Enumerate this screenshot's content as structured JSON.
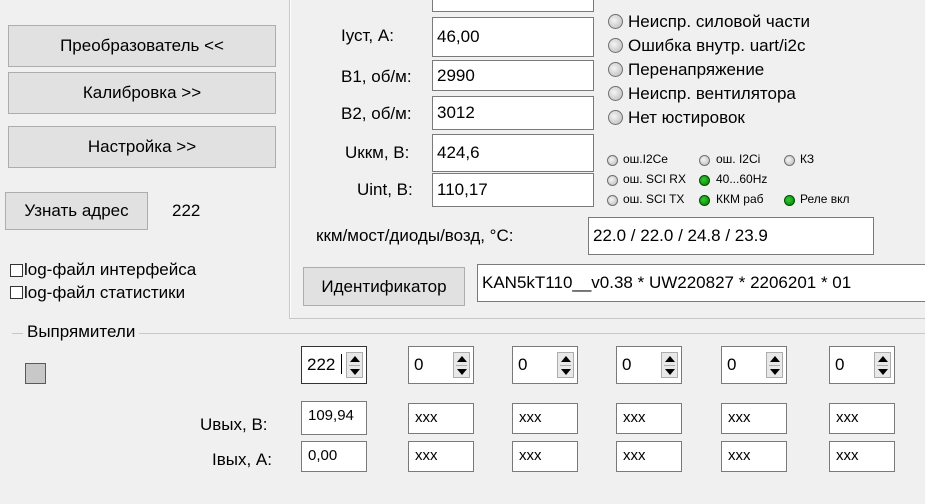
{
  "left": {
    "converter_button": "Преобразователь <<",
    "calibration_button": "Калибровка >>",
    "settings_button": "Настройка >>",
    "get_address_button": "Узнать адрес",
    "address_value": "222",
    "log_interface_label": "log-файл интерфейса",
    "log_stats_label": "log-файл статистики"
  },
  "measurements": {
    "iust_label": "Iуст, А:",
    "iust_value": "46,00",
    "b1_label": "В1, об/м:",
    "b1_value": "2990",
    "b2_label": "В2, об/м:",
    "b2_value": "3012",
    "ukkm_label": "Uккм, В:",
    "ukkm_value": "424,6",
    "uint_label": "Uint, В:",
    "uint_value": "110,17",
    "temps_label": "ккм/мост/диоды/возд, °С:",
    "temps_value": "22.0 / 22.0 / 24.8 / 23.9"
  },
  "faults": [
    "Неиспр. силовой части",
    "Ошибка внутр. uart/i2c",
    "Перенапряжение",
    "Неиспр. вентилятора",
    "Нет юстировок"
  ],
  "small_indicators": {
    "row1": [
      "ош.I2Ce",
      "ош. I2Ci",
      "КЗ"
    ],
    "row2": [
      "ош. SCI RX",
      "40...60Hz"
    ],
    "row3": [
      "ош. SCI TX",
      "ККМ раб",
      "Реле вкл"
    ],
    "green_color": "#0a9a0a",
    "off_color": "#c8c8c8"
  },
  "identifier": {
    "button": "Идентификатор",
    "value": "KAN5kT110__v0.38 * UW220827 * 2206201 * 01"
  },
  "rectifiers": {
    "group_label": "Выпрямители",
    "uout_label": "Uвых, В:",
    "iout_label": "Iвых, А:",
    "units": [
      {
        "addr": "222",
        "uout": "109,94",
        "iout": "0,00"
      },
      {
        "addr": "0",
        "uout": "xxx",
        "iout": "xxx"
      },
      {
        "addr": "0",
        "uout": "xxx",
        "iout": "xxx"
      },
      {
        "addr": "0",
        "uout": "xxx",
        "iout": "xxx"
      },
      {
        "addr": "0",
        "uout": "xxx",
        "iout": "xxx"
      },
      {
        "addr": "0",
        "uout": "xxx",
        "iout": "xxx"
      }
    ]
  }
}
